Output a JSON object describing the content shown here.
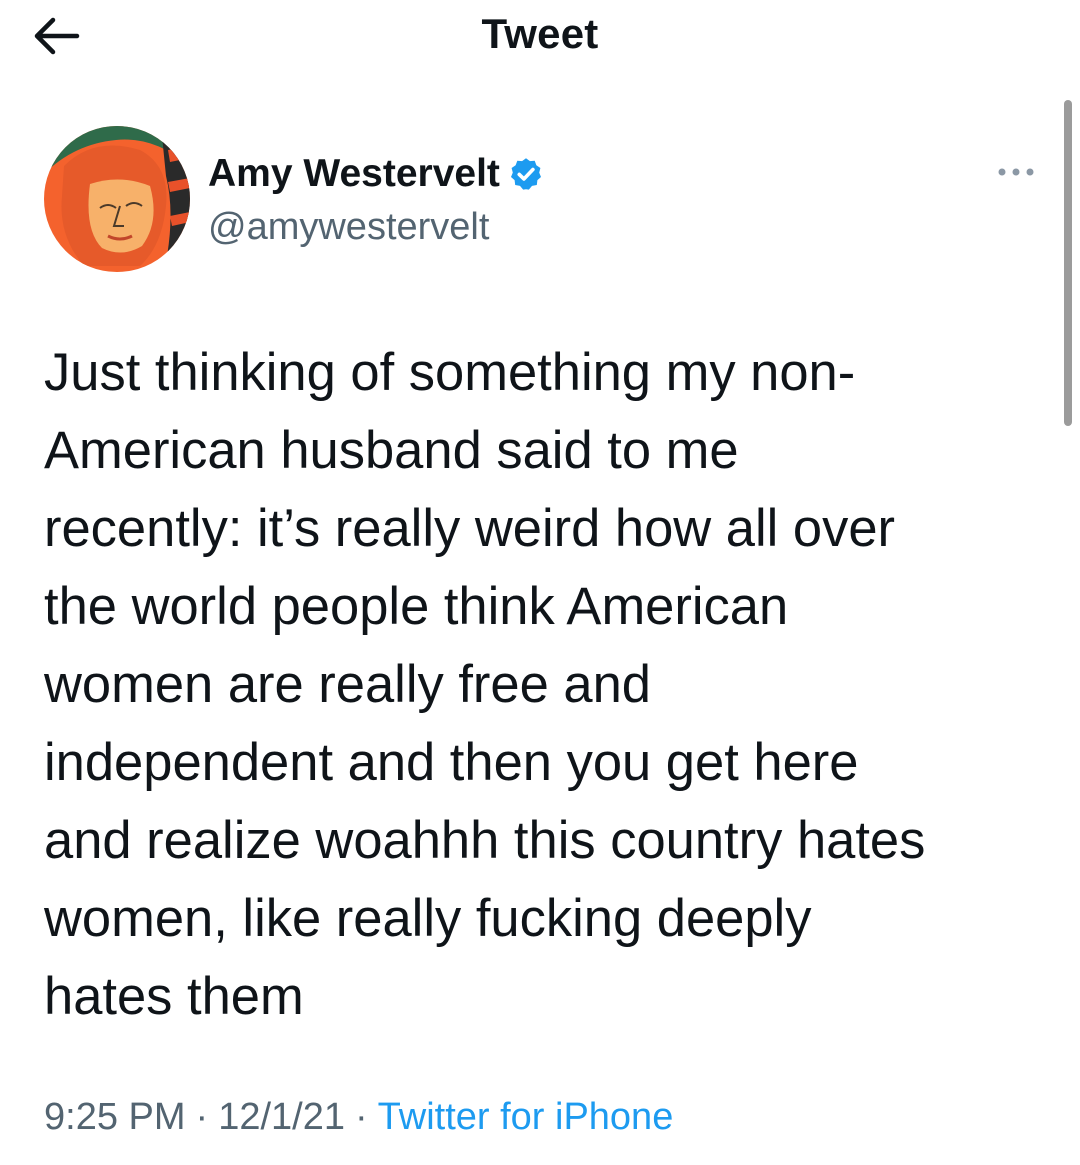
{
  "header": {
    "title": "Tweet",
    "back_icon": "arrow-left-icon"
  },
  "author": {
    "name": "Amy Westervelt",
    "handle": "@amywestervelt",
    "verified": true,
    "verified_icon": "verified-badge-icon",
    "more_icon": "more-horizontal-icon"
  },
  "tweet": {
    "text": "Just thinking of something my non-\nAmerican husband said to me\nrecently: it’s really weird how all over\nthe world people think American\nwomen are really free and\nindependent and then you get here\nand realize woahhh this country hates\nwomen, like really fucking deeply\nhates them",
    "time": "9:25 PM",
    "separator": "·",
    "date": "12/1/21",
    "source": "Twitter for iPhone"
  },
  "colors": {
    "text": "#0f1419",
    "secondary": "#536471",
    "accent": "#1d9bf0"
  }
}
